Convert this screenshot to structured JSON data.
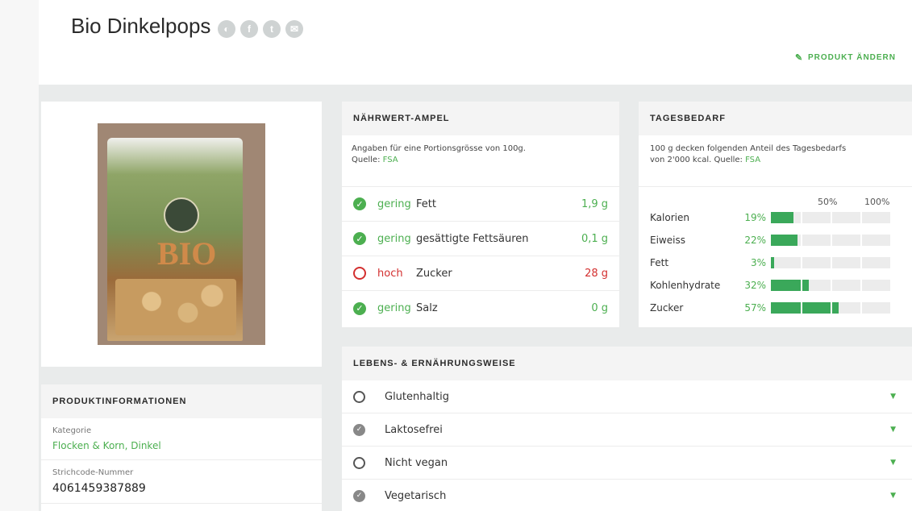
{
  "header": {
    "title": "Bio Dinkelpops",
    "share_icons": [
      {
        "icon": "share-icon",
        "glyph": "◐"
      },
      {
        "icon": "facebook-icon",
        "glyph": "f"
      },
      {
        "icon": "twitter-icon",
        "glyph": "t"
      },
      {
        "icon": "email-icon",
        "glyph": "✉"
      }
    ],
    "edit_label": "PRODUKT ÄNDERN"
  },
  "naehrwert": {
    "title": "NÄHRWERT-AMPEL",
    "info_line1": "Angaben für eine Portionsgrösse von 100g.",
    "source_label": "Quelle:",
    "source_link": "FSA",
    "rows": [
      {
        "status": "ok",
        "level": "gering",
        "nutrient": "Fett",
        "amount": "1,9 g"
      },
      {
        "status": "ok",
        "level": "gering",
        "nutrient": "gesättigte Fettsäuren",
        "amount": "0,1 g"
      },
      {
        "status": "high",
        "level": "hoch",
        "nutrient": "Zucker",
        "amount": "28 g"
      },
      {
        "status": "ok",
        "level": "gering",
        "nutrient": "Salz",
        "amount": "0 g"
      }
    ]
  },
  "tagesbedarf": {
    "title": "TAGESBEDARF",
    "info_line1": "100 g decken folgenden Anteil des Tagesbedarfs",
    "info_line2": "von 2'000 kcal. Quelle:",
    "source_link": "FSA",
    "scale_50": "50%",
    "scale_100": "100%",
    "rows": [
      {
        "name": "Kalorien",
        "pct_label": "19%",
        "pct": 19
      },
      {
        "name": "Eiweiss",
        "pct_label": "22%",
        "pct": 22
      },
      {
        "name": "Fett",
        "pct_label": "3%",
        "pct": 3
      },
      {
        "name": "Kohlenhydrate",
        "pct_label": "32%",
        "pct": 32
      },
      {
        "name": "Zucker",
        "pct_label": "57%",
        "pct": 57
      }
    ]
  },
  "lebens": {
    "title": "LEBENS- & ERNÄHRUNGSWEISE",
    "items": [
      {
        "state": "no",
        "label": "Glutenhaltig"
      },
      {
        "state": "yes",
        "label": "Laktosefrei"
      },
      {
        "state": "no",
        "label": "Nicht vegan"
      },
      {
        "state": "yes",
        "label": "Vegetarisch"
      }
    ]
  },
  "produktinfo": {
    "title": "PRODUKTINFORMATIONEN",
    "kategorie_label": "Kategorie",
    "kategorie_value": "Flocken & Korn, Dinkel",
    "barcode_label": "Strichcode-Nummer",
    "barcode_value": "4061459387889"
  },
  "colors": {
    "accent": "#4caf50",
    "warning": "#d32f2f",
    "bar": "#3aa85a"
  }
}
